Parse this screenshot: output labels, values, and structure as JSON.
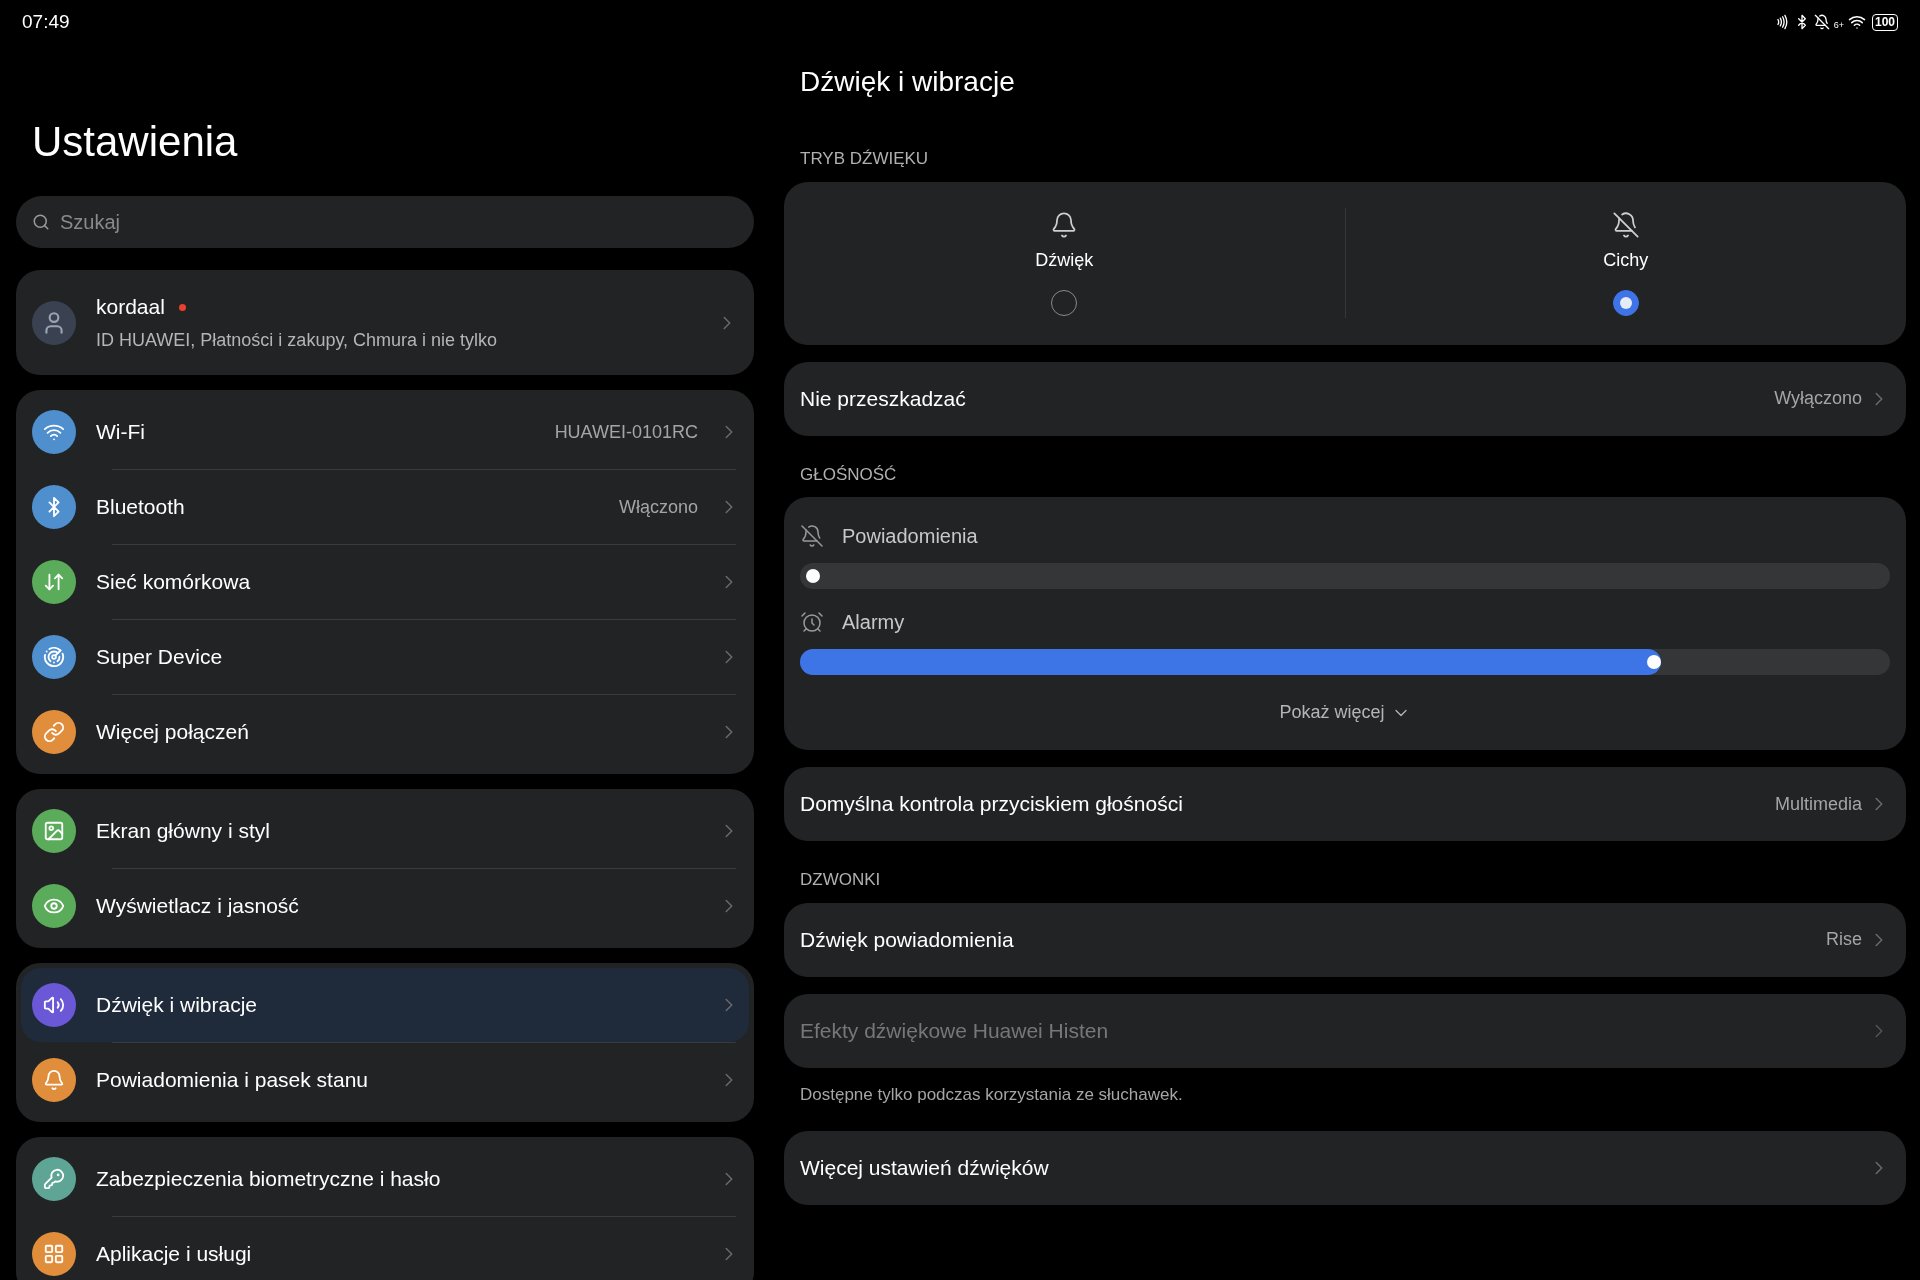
{
  "status_bar": {
    "time": "07:49",
    "wifi_badge": "6+",
    "battery": "100"
  },
  "sidebar": {
    "title": "Ustawienia",
    "search": {
      "placeholder": "Szukaj"
    },
    "profile": {
      "name": "kordaal",
      "notification_dot": true,
      "subtitle": "ID HUAWEI, Płatności i zakupy, Chmura i nie tylko"
    },
    "groups": [
      {
        "items": [
          {
            "label": "Wi-Fi",
            "value": "HUAWEI-0101RC",
            "color": "#4f8fce",
            "selected": false
          },
          {
            "label": "Bluetooth",
            "value": "Włączono",
            "color": "#4f8fce",
            "selected": false
          },
          {
            "label": "Sieć komórkowa",
            "color": "#5aac5a",
            "selected": false
          },
          {
            "label": "Super Device",
            "color": "#4f8fce",
            "selected": false
          },
          {
            "label": "Więcej połączeń",
            "color": "#e08e3c",
            "selected": false
          }
        ]
      },
      {
        "items": [
          {
            "label": "Ekran główny i styl",
            "color": "#5aac5a",
            "selected": false
          },
          {
            "label": "Wyświetlacz i jasność",
            "color": "#5aac5a",
            "selected": false
          }
        ]
      },
      {
        "items": [
          {
            "label": "Dźwięk i wibracje",
            "color": "#6a58d6",
            "selected": true
          },
          {
            "label": "Powiadomienia i pasek stanu",
            "color": "#e08e3c",
            "selected": false
          }
        ]
      },
      {
        "items": [
          {
            "label": "Zabezpieczenia biometryczne i hasło",
            "color": "#5ea596",
            "selected": false
          },
          {
            "label": "Aplikacje i usługi",
            "color": "#e08e3c",
            "selected": false
          }
        ]
      }
    ]
  },
  "content": {
    "title": "Dźwięk i wibracje",
    "sound_mode": {
      "heading": "TRYB DŹWIĘKU",
      "options": [
        {
          "label": "Dźwięk",
          "selected": false
        },
        {
          "label": "Cichy",
          "selected": true
        }
      ]
    },
    "dnd_row": {
      "label": "Nie przeszkadzać",
      "value": "Wyłączono"
    },
    "volume": {
      "heading": "GŁOŚNOŚĆ",
      "sliders": [
        {
          "label": "Powiadomienia",
          "level": 0
        },
        {
          "label": "Alarmy",
          "level": 0.79
        }
      ],
      "show_more": "Pokaż więcej"
    },
    "default_control_row": {
      "label": "Domyślna kontrola przyciskiem głośności",
      "value": "Multimedia"
    },
    "ringtones": {
      "heading": "DZWONKI",
      "rows": [
        {
          "label": "Dźwięk powiadomienia",
          "value": "Rise",
          "disabled": false
        },
        {
          "label": "Efekty dźwiękowe Huawei Histen",
          "disabled": true,
          "note": "Dostępne tylko podczas korzystania ze słuchawek."
        },
        {
          "label": "Więcej ustawień dźwięków",
          "disabled": false
        }
      ]
    }
  }
}
